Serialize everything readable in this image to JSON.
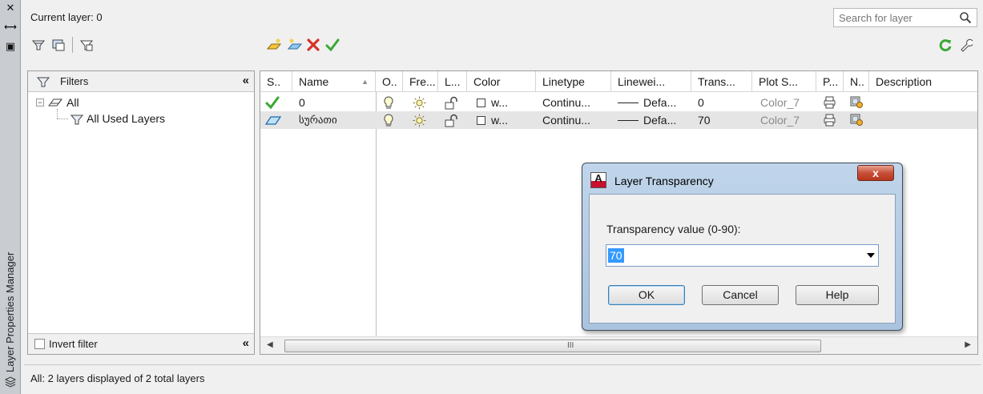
{
  "palette": {
    "title": "Layer Properties Manager",
    "close_glyph": "✕",
    "autohide_glyph": "⟷",
    "properties_glyph": "▣"
  },
  "header": {
    "current_layer": "Current layer: 0",
    "search_placeholder": "Search for layer"
  },
  "filters": {
    "title": "Filters",
    "collapse_glyph": "«",
    "tree": [
      {
        "label": "All",
        "icon": "filter-all-icon"
      },
      {
        "label": "All Used Layers",
        "icon": "layer-filter-icon"
      }
    ],
    "invert_label": "Invert filter"
  },
  "grid": {
    "columns": [
      "S..",
      "Name",
      "O..",
      "Fre...",
      "L...",
      "Color",
      "Linetype",
      "Linewei...",
      "Trans...",
      "Plot S...",
      "P...",
      "N..",
      "Description"
    ],
    "rows": [
      {
        "status": "current",
        "name": "0",
        "color": "w...",
        "linetype": "Continu...",
        "lineweight": "Defa...",
        "transparency": "0",
        "plot_style": "Color_7"
      },
      {
        "status": "layer",
        "name": "სურათი",
        "color": "w...",
        "linetype": "Continu...",
        "lineweight": "Defa...",
        "transparency": "70",
        "plot_style": "Color_7"
      }
    ],
    "scroll_grip": "III"
  },
  "status": {
    "text": "All: 2 layers displayed of 2 total layers"
  },
  "dialog": {
    "title": "Layer Transparency",
    "app_letter": "A",
    "close_label": "x",
    "prompt": "Transparency value (0-90):",
    "value": "70",
    "buttons": {
      "ok": "OK",
      "cancel": "Cancel",
      "help": "Help"
    }
  },
  "colors": {
    "accent_green": "#3aa835",
    "delete_red": "#d6322a",
    "selection_blue": "#3399ff",
    "title_bar": "#b4cbe4"
  }
}
